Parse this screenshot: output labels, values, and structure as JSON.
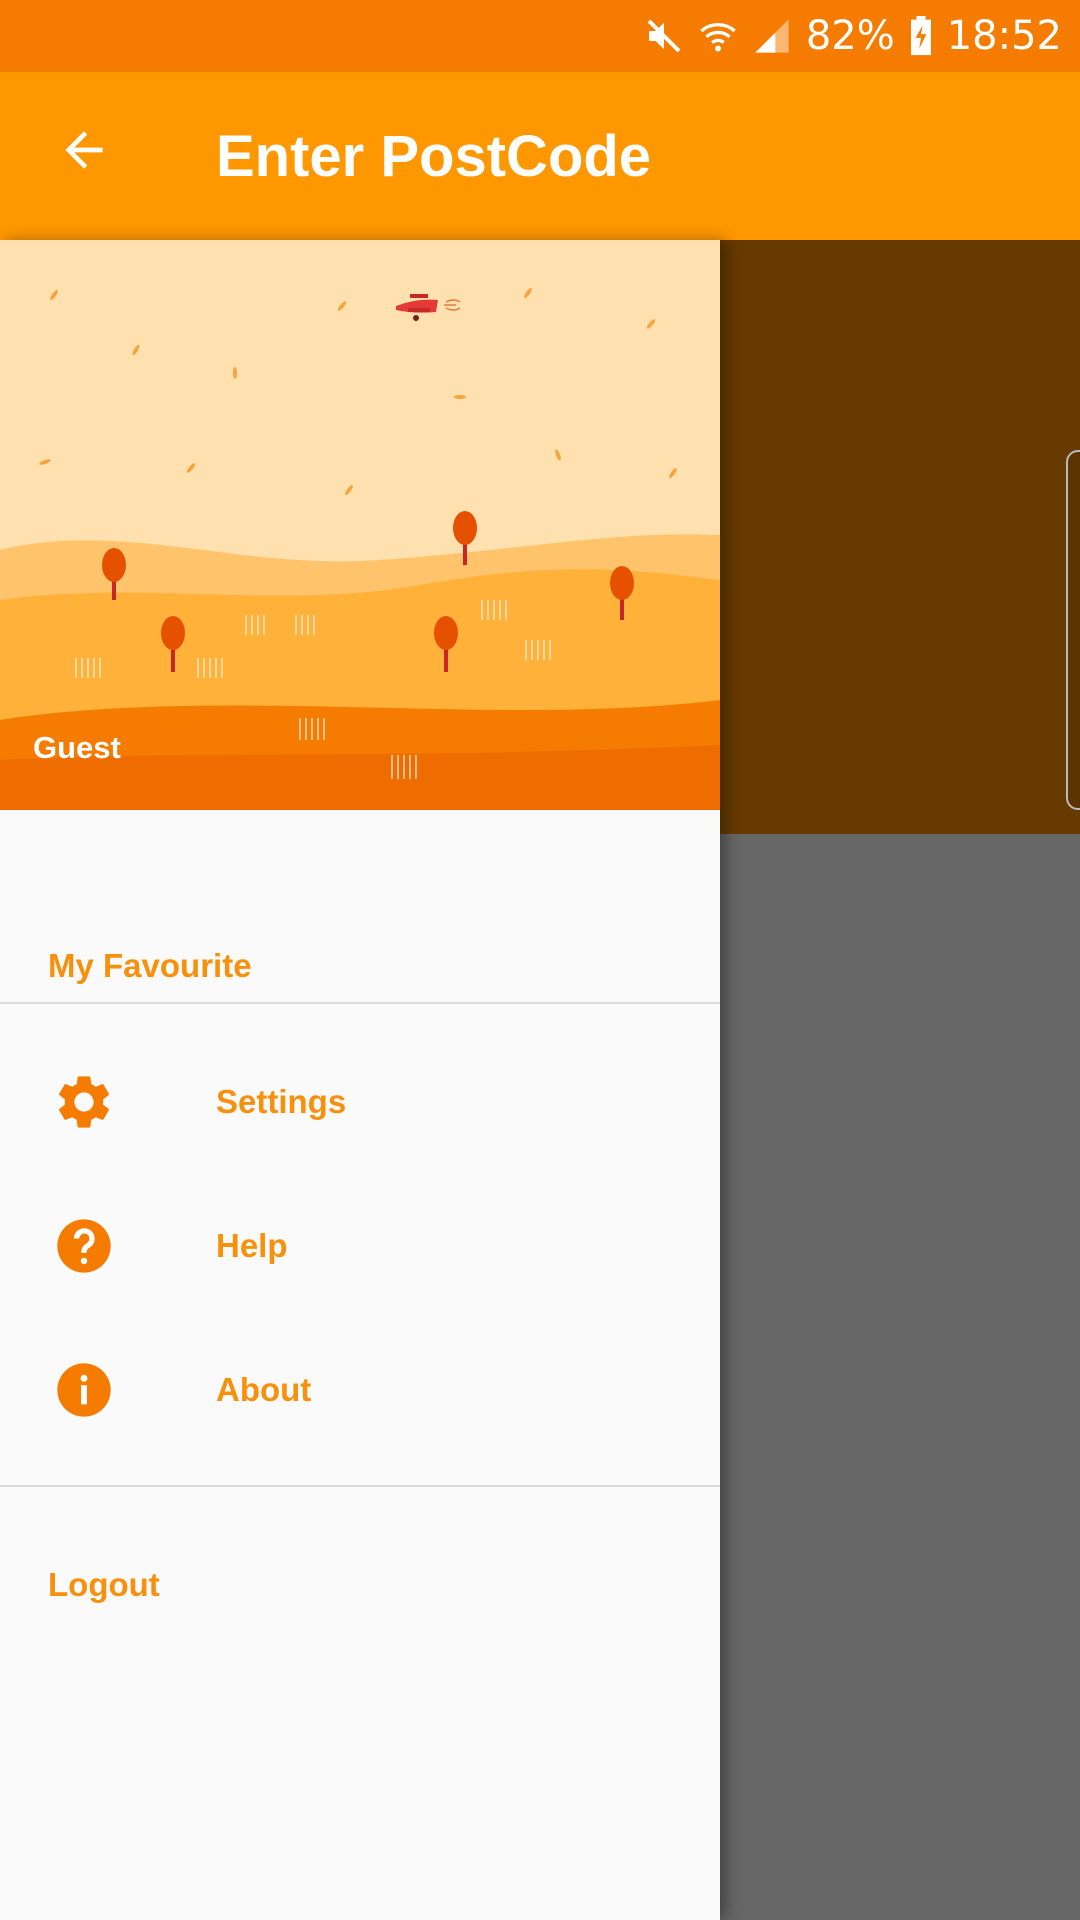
{
  "status_bar": {
    "battery": "82%",
    "time": "18:52",
    "icons": [
      "mute-icon",
      "wifi-icon",
      "signal-icon",
      "battery-charging-icon"
    ]
  },
  "app_bar": {
    "title": "Enter PostCode",
    "back_icon": "arrow-back-icon"
  },
  "drawer": {
    "user_name": "Guest",
    "favourite_label": "My Favourite",
    "items": [
      {
        "label": "Settings",
        "icon": "gear-icon"
      },
      {
        "label": "Help",
        "icon": "help-icon"
      },
      {
        "label": "About",
        "icon": "info-icon"
      }
    ],
    "logout_label": "Logout"
  },
  "colors": {
    "status_bar": "#f57c00",
    "app_bar": "#ff9800",
    "menu_text": "#f7910d",
    "scrim_top": "#663a00",
    "scrim_bottom": "#666666"
  }
}
